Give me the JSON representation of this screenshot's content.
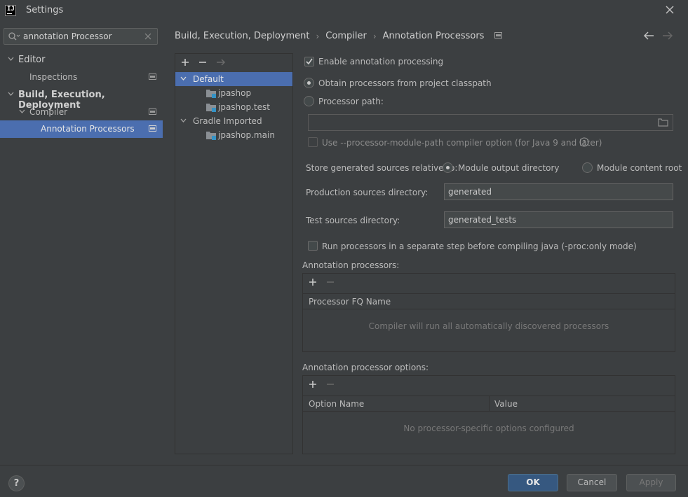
{
  "window": {
    "title": "Settings"
  },
  "search": {
    "value": "annotation Processor"
  },
  "sidebar": {
    "items": [
      {
        "label": "Editor"
      },
      {
        "label": "Inspections"
      },
      {
        "label": "Build, Execution, Deployment"
      },
      {
        "label": "Compiler"
      },
      {
        "label": "Annotation Processors"
      }
    ]
  },
  "breadcrumb": {
    "items": [
      "Build, Execution, Deployment",
      "Compiler",
      "Annotation Processors"
    ],
    "separator": "›"
  },
  "modules": {
    "items": [
      {
        "label": "Default"
      },
      {
        "label": "jpashop"
      },
      {
        "label": "jpashop.test"
      },
      {
        "label": "Gradle Imported"
      },
      {
        "label": "jpashop.main"
      }
    ]
  },
  "settings": {
    "enable_annotation_processing": "Enable annotation processing",
    "obtain_from_classpath": "Obtain processors from project classpath",
    "processor_path": "Processor path:",
    "use_module_path": "Use --processor-module-path compiler option (for Java 9 and later)",
    "store_relative_to": "Store generated sources relative to:",
    "module_output_directory": "Module output directory",
    "module_content_root": "Module content root",
    "production_sources_label": "Production sources directory:",
    "production_sources_value": "generated",
    "test_sources_label": "Test sources directory:",
    "test_sources_value": "generated_tests",
    "run_separate_step": "Run processors in a separate step before compiling java (-proc:only mode)"
  },
  "annotation_processors": {
    "title": "Annotation processors:",
    "column": "Processor FQ Name",
    "empty": "Compiler will run all automatically discovered processors"
  },
  "processor_options": {
    "title": "Annotation processor options:",
    "columns": [
      "Option Name",
      "Value"
    ],
    "empty": "No processor-specific options configured"
  },
  "footer": {
    "help": "?",
    "ok": "OK",
    "cancel": "Cancel",
    "apply": "Apply"
  },
  "colors": {
    "background": "#3c3f41",
    "selection": "#4b6eaf",
    "primary_button": "#365880"
  }
}
